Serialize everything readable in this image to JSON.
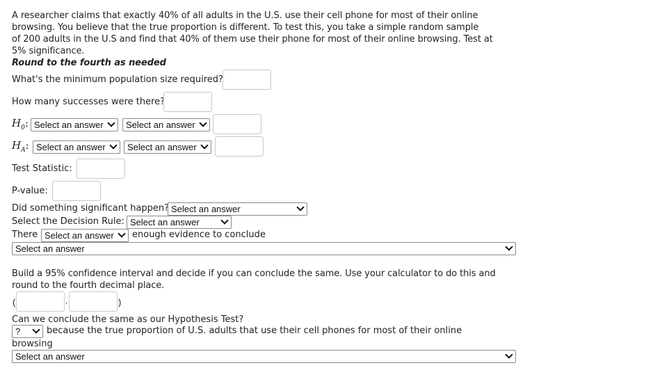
{
  "problem": {
    "lines": [
      "A researcher claims that exactly 40% of all adults in the U.S. use their cell phone for most of their online",
      "browsing. You believe that the true proportion is different. To test this, you take a simple random sample",
      "of 200 adults in the U.S and find that 40% of them use their phone for most of their online browsing. Test at",
      "5% significance."
    ],
    "rounding_note": "Round to the fourth as needed"
  },
  "questions": {
    "min_population": {
      "label": "What's the minimum population size required?",
      "value": ""
    },
    "successes": {
      "label": "How many successes were there?",
      "value": ""
    },
    "h0": {
      "symbol": "H",
      "sub": "0",
      "colon": ":",
      "select1": "Select an answer",
      "select2": "Select an answer",
      "value": ""
    },
    "ha": {
      "symbol": "H",
      "sub": "A",
      "colon": ":",
      "select1": "Select an answer",
      "select2": "Select an answer",
      "value": ""
    },
    "test_statistic": {
      "label": "Test Statistic:",
      "value": ""
    },
    "p_value": {
      "label": "P-value:",
      "value": ""
    },
    "significant": {
      "label": "Did something significant happen?",
      "select": "Select an answer"
    },
    "decision_rule": {
      "label": "Select the Decision Rule:",
      "select": "Select an answer"
    },
    "conclusion": {
      "prefix": "There",
      "select": "Select an answer",
      "suffix": "enough evidence to conclude",
      "select2": "Select an answer"
    }
  },
  "confidence_interval": {
    "instructions": [
      "Build a 95% confidence interval and decide if you can conclude the same. Use your calculator to do this and",
      "round to the fourth decimal place."
    ],
    "open_paren": "(",
    "comma": ",",
    "close_paren": ")",
    "lower": "",
    "upper": "",
    "same_question": "Can we conclude the same as our Hypothesis Test?",
    "same_select": "?",
    "because_text": "because the true proportion of U.S. adults that use their cell phones for most of their online",
    "because_text2": "browsing",
    "final_select": "Select an answer"
  }
}
